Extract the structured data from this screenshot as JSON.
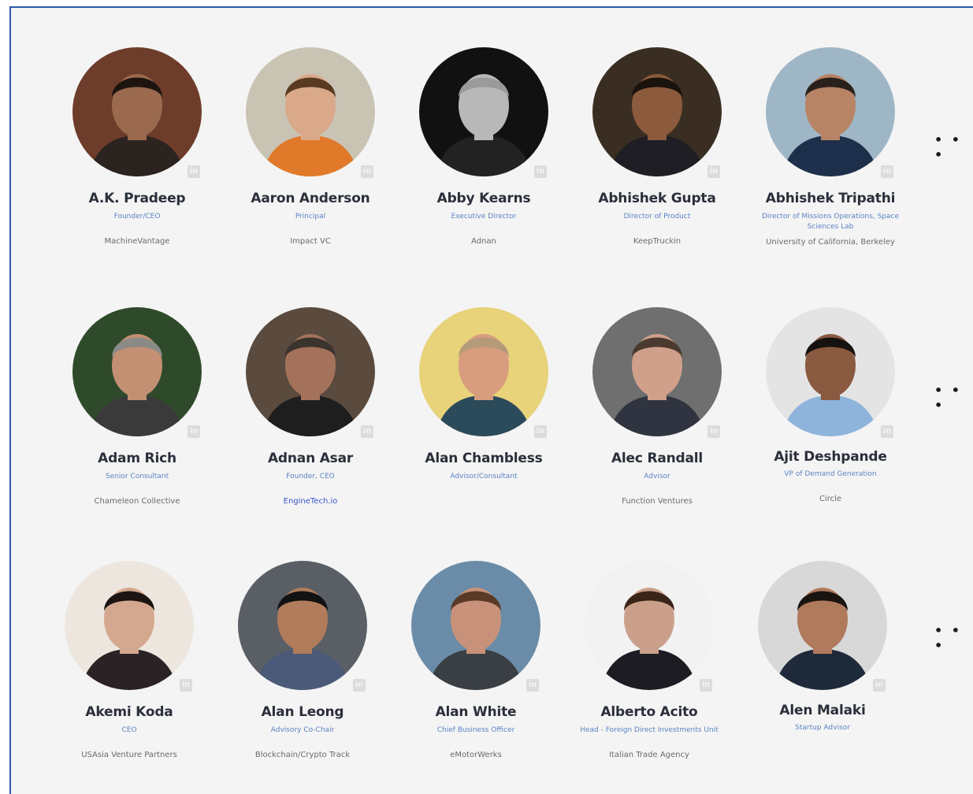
{
  "more_label": "• • •",
  "linkedin_icon_label": "in",
  "speakers": [
    {
      "name": "A.K. Pradeep",
      "title": "Founder/CEO",
      "company": "MachineVantage",
      "bg": "#6e3c2a",
      "skin": "#9b6a4e",
      "hair": "#1d1410",
      "shirt": "#2b2320"
    },
    {
      "name": "Aaron Anderson",
      "title": "Principal",
      "company": "Impact VC",
      "bg": "#c9c3b4",
      "skin": "#d9a98a",
      "hair": "#5b3a22",
      "shirt": "#e07a2a"
    },
    {
      "name": "Abby Kearns",
      "title": "Executive Director",
      "company": "Adnan",
      "bg": "#111111",
      "skin": "#b8b8b8",
      "hair": "#9a9a9a",
      "shirt": "#222222"
    },
    {
      "name": "Abhishek Gupta",
      "title": "Director of Product",
      "company": "KeepTruckin",
      "bg": "#3a2e22",
      "skin": "#8c5a3c",
      "hair": "#1a120c",
      "shirt": "#1e1e24"
    },
    {
      "name": "Abhishek Tripathi",
      "title": "Director of Missions Operations, Space Sciences Lab",
      "company": "University of California, Berkeley",
      "bg": "#9fb6c6",
      "skin": "#b88466",
      "hair": "#2a211c",
      "shirt": "#1d2f4a"
    },
    {
      "name": "Adam Rich",
      "title": "Senior Consultant",
      "company": "Chameleon Collective",
      "bg": "#2f4a2a",
      "skin": "#c49074",
      "hair": "#8a8a86",
      "shirt": "#3a3a3a"
    },
    {
      "name": "Adnan Asar",
      "title": "Founder, CEO",
      "company": "EngineTech.io",
      "bg": "#5a4b3e",
      "skin": "#a4725a",
      "hair": "#3b332e",
      "shirt": "#1e1e1e"
    },
    {
      "name": "Alan Chambless",
      "title": "Advisor/Consultant",
      "company": "",
      "bg": "#e8d27a",
      "skin": "#d89c7e",
      "hair": "#b59a7a",
      "shirt": "#2b4a5a"
    },
    {
      "name": "Alec Randall",
      "title": "Advisor",
      "company": "Function Ventures",
      "bg": "#6f6f6f",
      "skin": "#d0a08a",
      "hair": "#4a3a30",
      "shirt": "#2f3440"
    },
    {
      "name": "Ajit Deshpande",
      "title": "VP of Demand Generation",
      "company": "Circle",
      "bg": "#e4e4e4",
      "skin": "#8a5a40",
      "hair": "#161210",
      "shirt": "#8fb4dc"
    },
    {
      "name": "Akemi Koda",
      "title": "CEO",
      "company": "USAsia Venture Partners",
      "bg": "#ece6de",
      "skin": "#d4a88e",
      "hair": "#1a1412",
      "shirt": "#2a2224"
    },
    {
      "name": "Alan Leong",
      "title": "Advisory Co-Chair",
      "company": "Blockchain/Crypto Track",
      "bg": "#5a5f66",
      "skin": "#b07c5c",
      "hair": "#121212",
      "shirt": "#4a5a78"
    },
    {
      "name": "Alan White",
      "title": "Chief Business Officer",
      "company": "eMotorWerks",
      "bg": "#6a8ca8",
      "skin": "#c8927a",
      "hair": "#5a3a26",
      "shirt": "#3a3f44"
    },
    {
      "name": "Alberto Acito",
      "title": "Head - Foreign Direct Investments Unit",
      "company": "Italian Trade Agency",
      "bg": "#f2f2f2",
      "skin": "#caa08a",
      "hair": "#3a2418",
      "shirt": "#1c1c22"
    },
    {
      "name": "Alen Malaki",
      "title": "Startup Advisor",
      "company": "",
      "bg": "#d8d8d8",
      "skin": "#b07a5c",
      "hair": "#1a1410",
      "shirt": "#1e2a3a"
    }
  ]
}
